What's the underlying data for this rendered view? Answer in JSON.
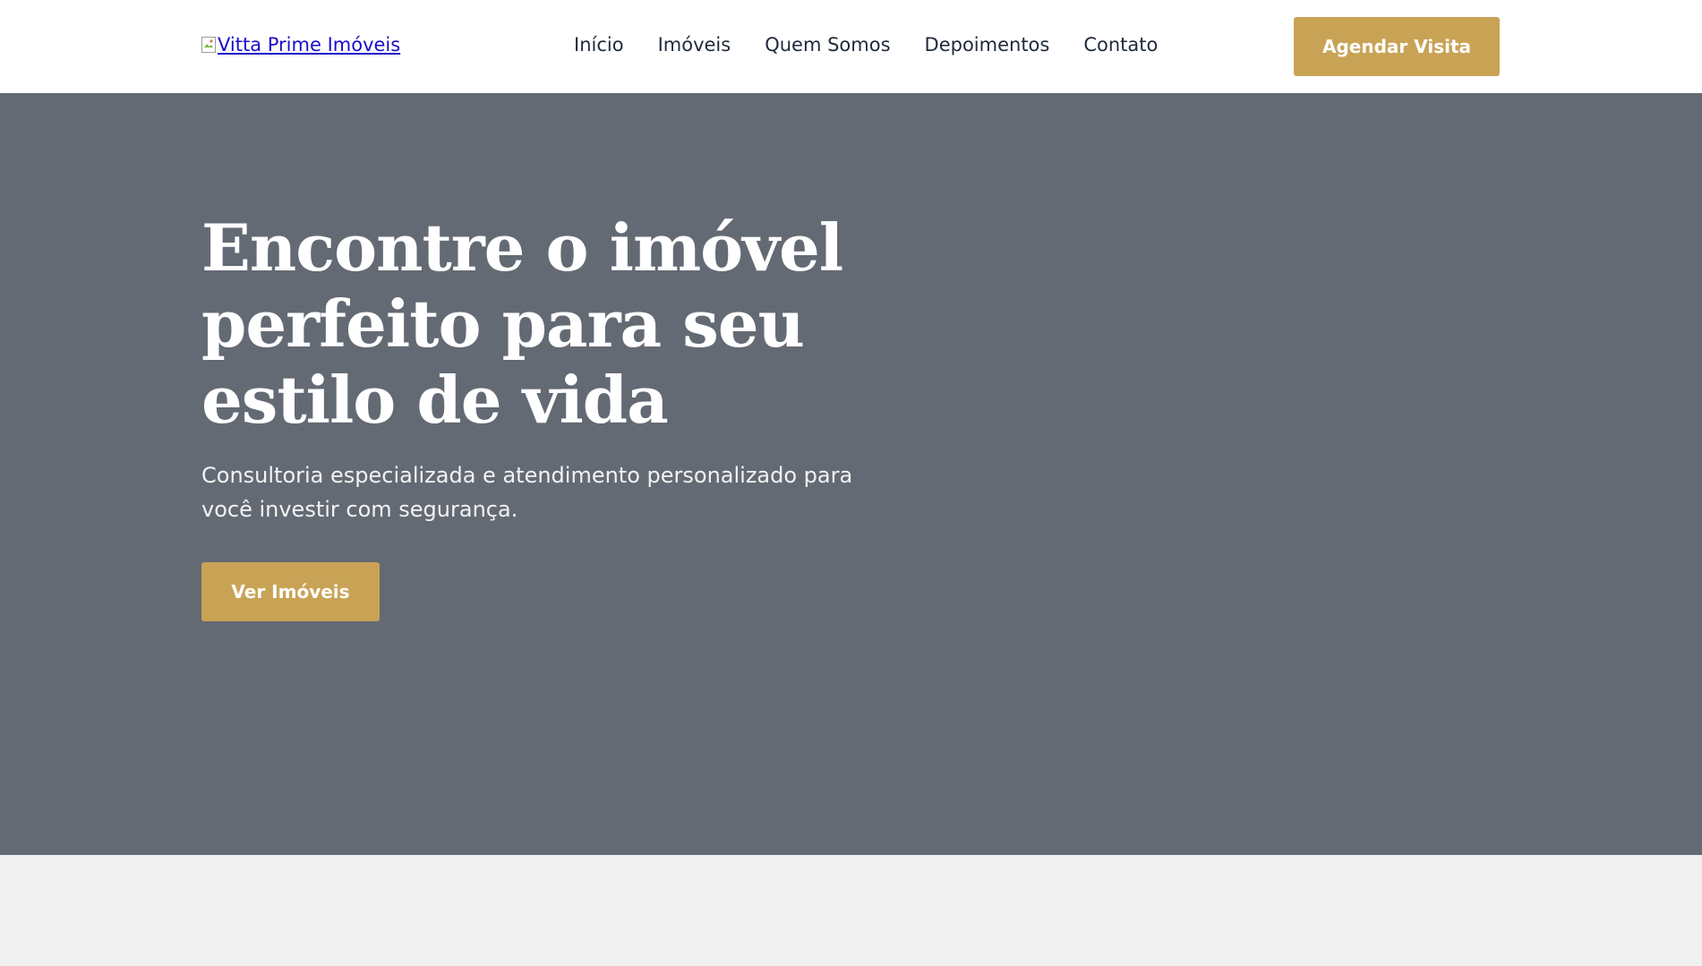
{
  "header": {
    "logo_alt": "Vitta Prime Imóveis",
    "nav": [
      {
        "label": "Início"
      },
      {
        "label": "Imóveis"
      },
      {
        "label": "Quem Somos"
      },
      {
        "label": "Depoimentos"
      },
      {
        "label": "Contato"
      }
    ],
    "cta_label": "Agendar Visita"
  },
  "hero": {
    "title": "Encontre o imóvel perfeito para seu estilo de vida",
    "subtitle": "Consultoria especializada e atendimento personalizado para você investir com segurança.",
    "cta_label": "Ver Imóveis"
  },
  "colors": {
    "accent": "#c9a355",
    "hero_bg": "#646a74",
    "link": "#1a0dcc"
  },
  "icons": {
    "logo": "broken-image-icon"
  }
}
